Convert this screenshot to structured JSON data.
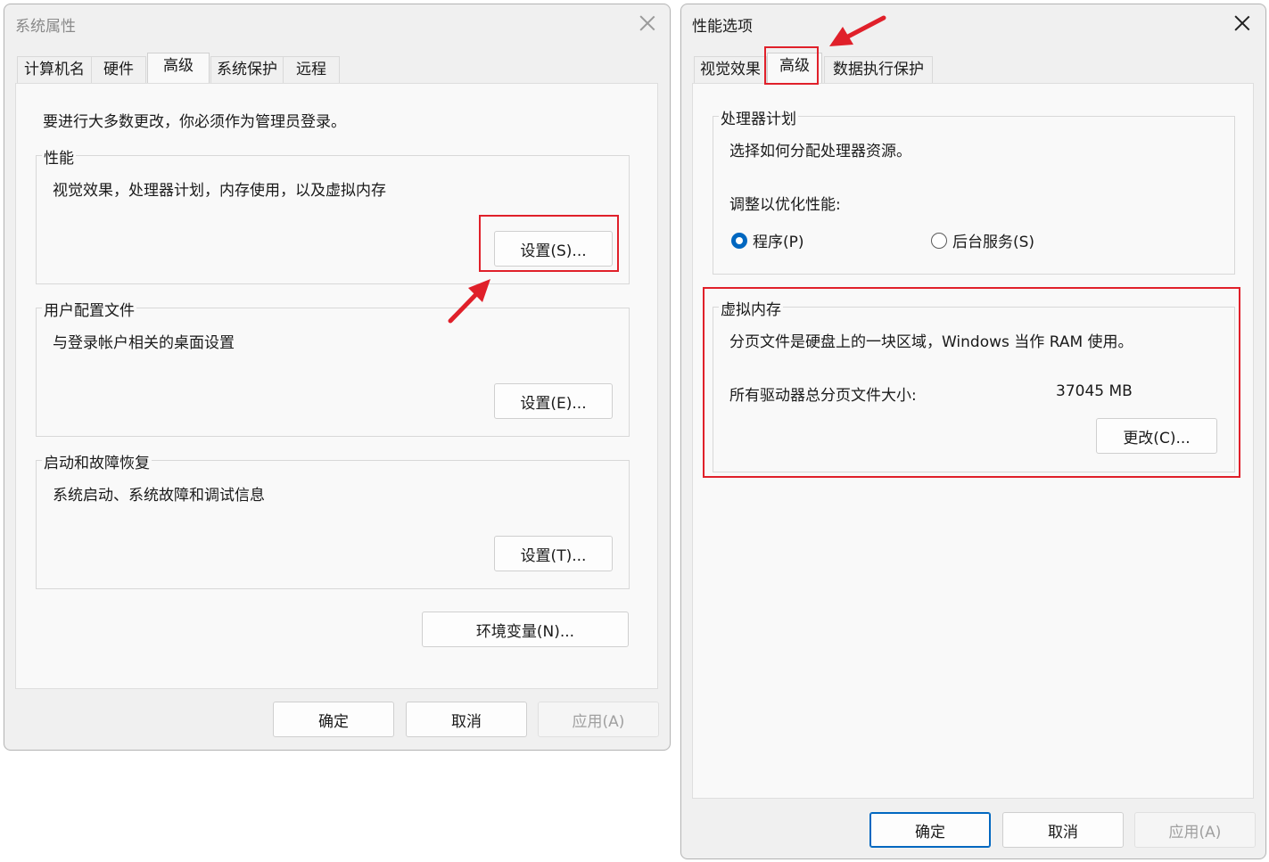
{
  "left_dialog": {
    "title": "系统属性",
    "tabs": [
      {
        "label": "计算机名"
      },
      {
        "label": "硬件"
      },
      {
        "label": "高级"
      },
      {
        "label": "系统保护"
      },
      {
        "label": "远程"
      }
    ],
    "admin_note": "要进行大多数更改，你必须作为管理员登录。",
    "performance": {
      "label": "性能",
      "description": "视觉效果，处理器计划，内存使用，以及虚拟内存",
      "button": "设置(S)..."
    },
    "user_profiles": {
      "label": "用户配置文件",
      "description": "与登录帐户相关的桌面设置",
      "button": "设置(E)..."
    },
    "startup_recovery": {
      "label": "启动和故障恢复",
      "description": "系统启动、系统故障和调试信息",
      "button": "设置(T)..."
    },
    "env_button": "环境变量(N)...",
    "ok": "确定",
    "cancel": "取消",
    "apply": "应用(A)"
  },
  "right_dialog": {
    "title": "性能选项",
    "tabs": [
      {
        "label": "视觉效果"
      },
      {
        "label": "高级"
      },
      {
        "label": "数据执行保护"
      }
    ],
    "processor": {
      "label": "处理器计划",
      "description": "选择如何分配处理器资源。",
      "optimize_label": "调整以优化性能:",
      "option_programs": "程序(P)",
      "option_background": "后台服务(S)"
    },
    "virtual_memory": {
      "label": "虚拟内存",
      "description": "分页文件是硬盘上的一块区域，Windows 当作 RAM 使用。",
      "total_label": "所有驱动器总分页文件大小:",
      "total_value": "37045 MB",
      "button": "更改(C)..."
    },
    "ok": "确定",
    "cancel": "取消",
    "apply": "应用(A)"
  },
  "colors": {
    "annotation_red": "#e0202a",
    "accent_blue": "#0067c0"
  }
}
